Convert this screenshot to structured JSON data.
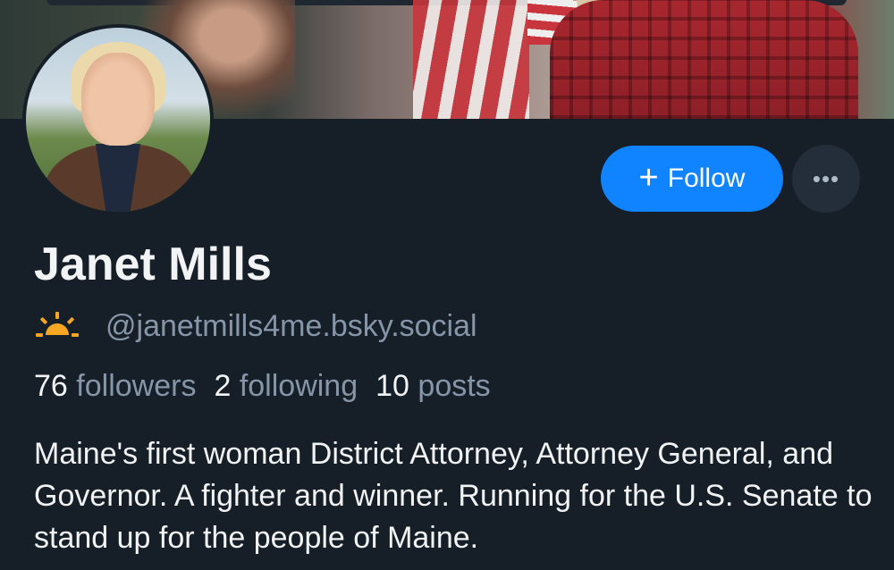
{
  "profile": {
    "display_name": "Janet Mills",
    "handle": "@janetmills4me.bsky.social",
    "handle_icon": "sun-icon",
    "stats": {
      "followers_count": "76",
      "followers_label": "followers",
      "following_count": "2",
      "following_label": "following",
      "posts_count": "10",
      "posts_label": "posts"
    },
    "bio": "Maine's first woman District Attorney, Attorney General, and Governor. A fighter and winner. Running for the U.S. Senate to stand up for the people of Maine."
  },
  "actions": {
    "follow_label": "Follow",
    "follow_icon": "plus-icon",
    "more_icon": "more-options-icon",
    "more_glyph": "•••"
  },
  "colors": {
    "background": "#161e27",
    "accent": "#1083fe",
    "text_primary": "#f1f3f5",
    "text_secondary": "#8696a8",
    "sun": "#f5a623"
  }
}
